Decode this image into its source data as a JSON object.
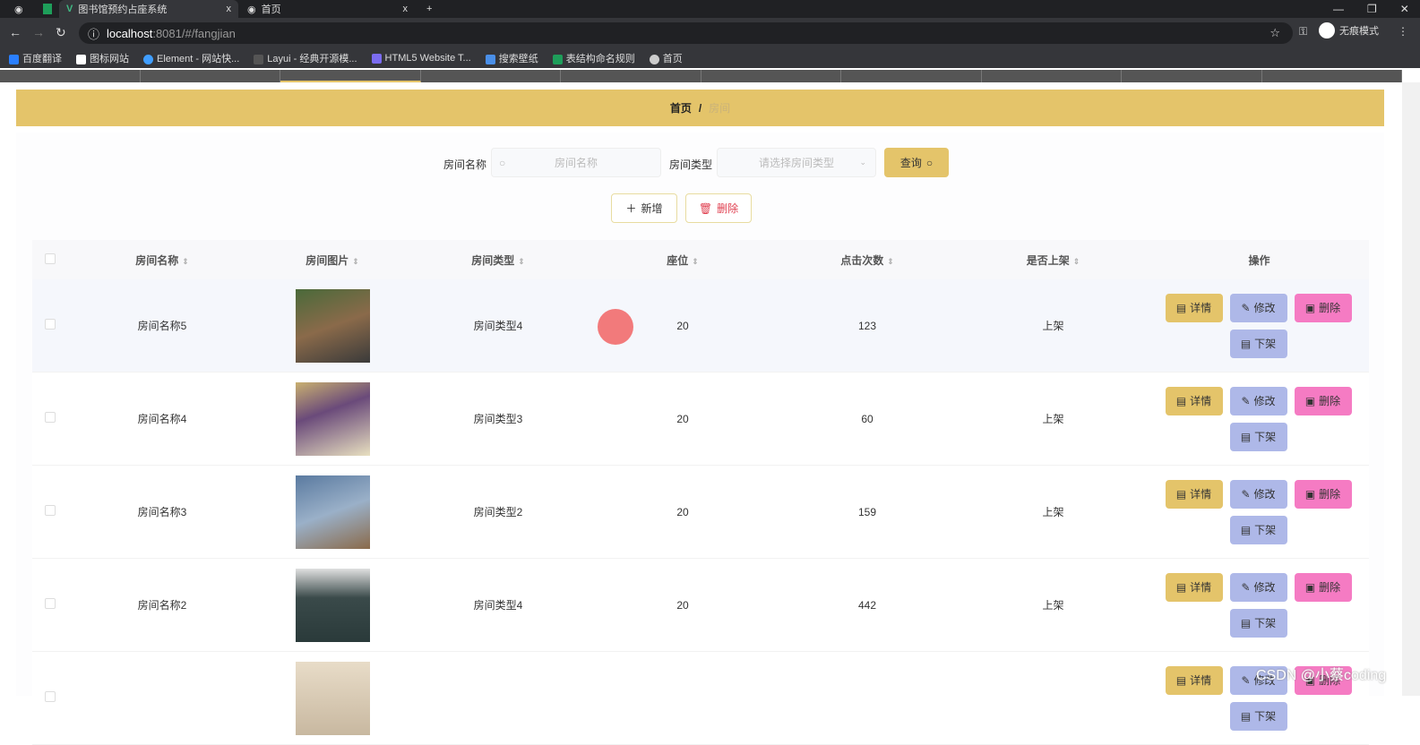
{
  "browser": {
    "tabs": [
      {
        "title": "图书馆预约占座系统",
        "close": "x"
      },
      {
        "title": "首页",
        "close": "x"
      }
    ],
    "new_tab": "+",
    "url_host": "localhost",
    "url_path": ":8081/#/fangjian",
    "incognito": "无痕模式",
    "bookmarks": [
      "百度翻译",
      "图标网站",
      "Element - 网站快...",
      "Layui - 经典开源模...",
      "HTML5 Website T...",
      "搜索壁纸",
      "表结构命名规则",
      "首页"
    ]
  },
  "breadcrumb": {
    "home": "首页",
    "sep": "/",
    "current": "房间"
  },
  "search": {
    "name_label": "房间名称",
    "name_placeholder": "房间名称",
    "type_label": "房间类型",
    "type_placeholder": "请选择房间类型",
    "query_button": "查询"
  },
  "toolbar": {
    "add": "新增",
    "delete": "删除"
  },
  "table": {
    "headers": [
      "房间名称",
      "房间图片",
      "房间类型",
      "座位",
      "点击次数",
      "是否上架",
      "操作"
    ],
    "rows": [
      {
        "name": "房间名称5",
        "type": "房间类型4",
        "seats": "20",
        "clicks": "123",
        "status": "上架"
      },
      {
        "name": "房间名称4",
        "type": "房间类型3",
        "seats": "20",
        "clicks": "60",
        "status": "上架"
      },
      {
        "name": "房间名称3",
        "type": "房间类型2",
        "seats": "20",
        "clicks": "159",
        "status": "上架"
      },
      {
        "name": "房间名称2",
        "type": "房间类型4",
        "seats": "20",
        "clicks": "442",
        "status": "上架"
      },
      {
        "name": "",
        "type": "",
        "seats": "",
        "clicks": "",
        "status": ""
      }
    ],
    "actions": {
      "detail": "详情",
      "edit": "修改",
      "delete": "删除",
      "offshelf": "下架"
    }
  },
  "watermark": "CSDN @小蔡coding"
}
